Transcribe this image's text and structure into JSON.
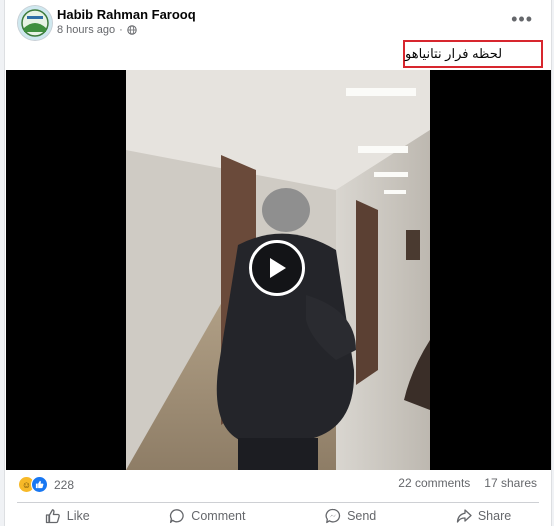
{
  "post": {
    "author": "Habib Rahman Farooq",
    "time": "8 hours ago",
    "privacy_icon": "globe-icon",
    "caption": "لحظه فرار نتانیاهو"
  },
  "stats": {
    "reaction_count": "228",
    "comments": "22 comments",
    "shares": "17 shares"
  },
  "actions": {
    "like": "Like",
    "comment": "Comment",
    "send": "Send",
    "share": "Share"
  },
  "colors": {
    "caption_border": "#d7262e",
    "like_blue": "#1877f2",
    "haha_yellow": "#f7b928"
  }
}
